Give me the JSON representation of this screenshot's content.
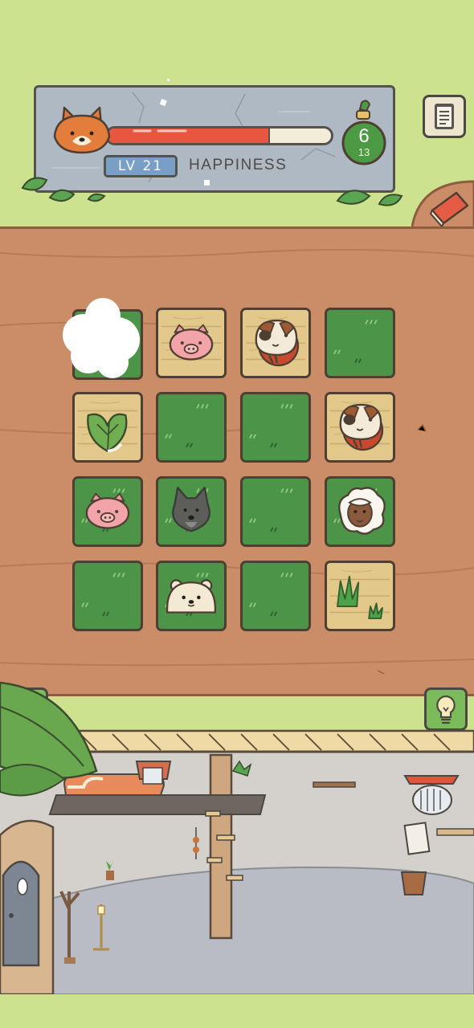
{
  "hud": {
    "level_label": "LV 21",
    "status_label": "HAPPINESS",
    "happiness_fraction": 0.72,
    "moves_current": "6",
    "moves_total": "13"
  },
  "board": {
    "rows": [
      [
        "pig-in-cloud",
        "pig",
        "hamster",
        "grass"
      ],
      [
        "spinach",
        "grass",
        "grass",
        "hamster"
      ],
      [
        "pig",
        "wolf",
        "grass",
        "sheep"
      ],
      [
        "grass",
        "polar-bear",
        "grass",
        "tall-grass"
      ]
    ]
  },
  "buttons": {
    "menu_icon": "notepad-icon",
    "book_icon": "red-book-icon",
    "undo_icon": "undo-arrow-icon",
    "hint_icon": "lightbulb-icon"
  },
  "colors": {
    "background_green": "#cde28e",
    "board_wood": "#cb8d68",
    "grass_tile": "#4c9447",
    "wood_tile": "#e2c88b",
    "happiness_red": "#e9563f",
    "level_badge": "#7a9fc6"
  }
}
